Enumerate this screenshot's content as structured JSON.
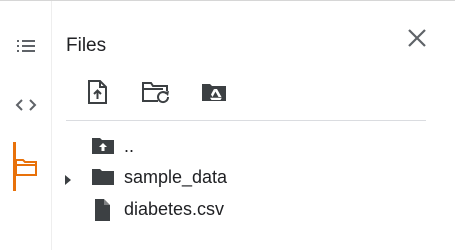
{
  "panel": {
    "title": "Files"
  },
  "left_rail": {
    "items": [
      {
        "icon": "table-of-contents-icon"
      },
      {
        "icon": "code-snippets-icon"
      },
      {
        "icon": "files-folder-icon",
        "active": true
      }
    ]
  },
  "toolbar": {
    "buttons": [
      {
        "icon": "upload-file-icon"
      },
      {
        "icon": "refresh-folder-icon"
      },
      {
        "icon": "mount-drive-icon"
      }
    ]
  },
  "file_tree": [
    {
      "label": "..",
      "type": "parent-folder",
      "icon": "folder-up-icon"
    },
    {
      "label": "sample_data",
      "type": "folder",
      "icon": "folder-icon",
      "expandable": true,
      "expanded": false
    },
    {
      "label": "diabetes.csv",
      "type": "file",
      "icon": "file-icon"
    }
  ],
  "colors": {
    "active_accent": "#e8710a",
    "icon_gray": "#5f6368",
    "text": "#202124",
    "divider": "#dadce0"
  }
}
